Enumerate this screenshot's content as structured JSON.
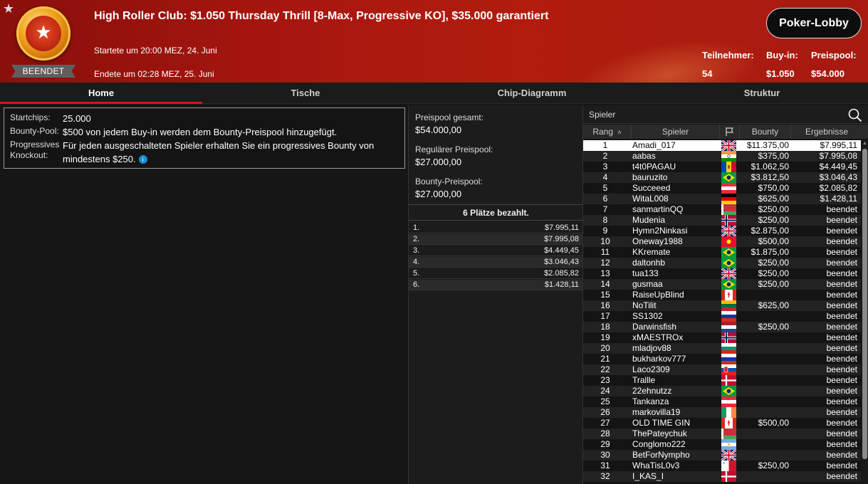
{
  "header": {
    "status": "BEENDET",
    "title": "High Roller Club: $1.050 Thursday Thrill [8-Max, Progressive KO], $35.000 garantiert",
    "started": "Startete um 20:00 MEZ, 24. Juni",
    "ended": "Endete um 02:28 MEZ, 25. Juni",
    "lobby_button": "Poker-Lobby",
    "stats": [
      {
        "label": "Teilnehmer:",
        "value": "54"
      },
      {
        "label": "Buy-in:",
        "value": "$1.050"
      },
      {
        "label": "Preispool:",
        "value": "$54.000"
      }
    ]
  },
  "tabs": [
    "Home",
    "Tische",
    "Chip-Diagramm",
    "Struktur"
  ],
  "info": {
    "startchips_label": "Startchips:",
    "startchips_value": "25.000",
    "bounty_label": "Bounty-Pool:",
    "bounty_value": "$500 von jedem Buy-in werden dem Bounty-Preispool hinzugefügt.",
    "pko_label": "Progressives Knockout:",
    "pko_value": "Für jeden ausgeschalteten Spieler erhalten Sie ein progressives Bounty von mindestens $250.",
    "info_icon": "i"
  },
  "pools": {
    "total_label": "Preispool gesamt:",
    "total_value": "$54.000,00",
    "regular_label": "Regulärer Preispool:",
    "regular_value": "$27.000,00",
    "bounty_label": "Bounty-Preispool:",
    "bounty_value": "$27.000,00"
  },
  "paid_heading": "6 Plätze bezahlt.",
  "payouts": [
    {
      "place": "1.",
      "amount": "$7.995,11"
    },
    {
      "place": "2.",
      "amount": "$7.995,08"
    },
    {
      "place": "3.",
      "amount": "$4.449,45"
    },
    {
      "place": "4.",
      "amount": "$3.046,43"
    },
    {
      "place": "5.",
      "amount": "$2.085,82"
    },
    {
      "place": "6.",
      "amount": "$1.428,11"
    }
  ],
  "players_panel": {
    "search_label": "Spieler",
    "columns": {
      "rank": "Rang",
      "player": "Spieler",
      "bounty": "Bounty",
      "results": "Ergebnisse"
    }
  },
  "players": [
    {
      "rank": "1",
      "name": "Amadi_017",
      "flag": "uk",
      "bounty": "$11.375,00",
      "result": "$7.995,11"
    },
    {
      "rank": "2",
      "name": "aabas",
      "flag": "india",
      "bounty": "$375,00",
      "result": "$7.995,08"
    },
    {
      "rank": "3",
      "name": "t4t0PAGAU",
      "flag": "moldova",
      "bounty": "$1.062,50",
      "result": "$4.449,45"
    },
    {
      "rank": "4",
      "name": "bauruzito",
      "flag": "brazil",
      "bounty": "$3.812,50",
      "result": "$3.046,43"
    },
    {
      "rank": "5",
      "name": "Succeeed",
      "flag": "austria",
      "bounty": "$750,00",
      "result": "$2.085,82"
    },
    {
      "rank": "6",
      "name": "WitaL008",
      "flag": "germany",
      "bounty": "$625,00",
      "result": "$1.428,11"
    },
    {
      "rank": "7",
      "name": "sanmartinQQ",
      "flag": "belarus",
      "bounty": "$250,00",
      "result": "beendet"
    },
    {
      "rank": "8",
      "name": "Mudenia",
      "flag": "norway",
      "bounty": "$250,00",
      "result": "beendet"
    },
    {
      "rank": "9",
      "name": "Hymn2Ninkasi",
      "flag": "uk",
      "bounty": "$2.875,00",
      "result": "beendet"
    },
    {
      "rank": "10",
      "name": "Oneway1988",
      "flag": "kyrgyzstan",
      "bounty": "$500,00",
      "result": "beendet"
    },
    {
      "rank": "11",
      "name": "KKremate",
      "flag": "brazil",
      "bounty": "$1.875,00",
      "result": "beendet"
    },
    {
      "rank": "12",
      "name": "daltonhb",
      "flag": "brazil",
      "bounty": "$250,00",
      "result": "beendet"
    },
    {
      "rank": "13",
      "name": "tua133",
      "flag": "uk",
      "bounty": "$250,00",
      "result": "beendet"
    },
    {
      "rank": "14",
      "name": "gusmaa",
      "flag": "brazil",
      "bounty": "$250,00",
      "result": "beendet"
    },
    {
      "rank": "15",
      "name": "RaiseUpBlind",
      "flag": "canada",
      "bounty": "",
      "result": "beendet"
    },
    {
      "rank": "16",
      "name": "NoTilit",
      "flag": "lithuania",
      "bounty": "$625,00",
      "result": "beendet"
    },
    {
      "rank": "17",
      "name": "SS1302",
      "flag": "russia",
      "bounty": "",
      "result": "beendet"
    },
    {
      "rank": "18",
      "name": "Darwinsfish",
      "flag": "netherlands",
      "bounty": "$250,00",
      "result": "beendet"
    },
    {
      "rank": "19",
      "name": "xMAESTROx",
      "flag": "norway",
      "bounty": "",
      "result": "beendet"
    },
    {
      "rank": "20",
      "name": "mladjov88",
      "flag": "bulgaria",
      "bounty": "",
      "result": "beendet"
    },
    {
      "rank": "21",
      "name": "bukharkov777",
      "flag": "russia",
      "bounty": "",
      "result": "beendet"
    },
    {
      "rank": "22",
      "name": "Laco2309",
      "flag": "slovakia",
      "bounty": "",
      "result": "beendet"
    },
    {
      "rank": "23",
      "name": "Trallle",
      "flag": "denmark",
      "bounty": "",
      "result": "beendet"
    },
    {
      "rank": "24",
      "name": "22ehnutzz",
      "flag": "brazil",
      "bounty": "",
      "result": "beendet"
    },
    {
      "rank": "25",
      "name": "Tankanza",
      "flag": "austria",
      "bounty": "",
      "result": "beendet"
    },
    {
      "rank": "26",
      "name": "markovilla19",
      "flag": "ireland",
      "bounty": "",
      "result": "beendet"
    },
    {
      "rank": "27",
      "name": "OLD TIME GIN",
      "flag": "canada",
      "bounty": "$500,00",
      "result": "beendet"
    },
    {
      "rank": "28",
      "name": "ThePateychuk",
      "flag": "belarus",
      "bounty": "",
      "result": "beendet"
    },
    {
      "rank": "29",
      "name": "Conglomo222",
      "flag": "argentina",
      "bounty": "",
      "result": "beendet"
    },
    {
      "rank": "30",
      "name": "BetForNympho",
      "flag": "uk",
      "bounty": "",
      "result": "beendet"
    },
    {
      "rank": "31",
      "name": "WhaTisL0v3",
      "flag": "malta",
      "bounty": "$250,00",
      "result": "beendet"
    },
    {
      "rank": "32",
      "name": "I_KAS_I",
      "flag": "denmark",
      "bounty": "",
      "result": "beendet"
    }
  ],
  "colors": {
    "accent": "#d7141a",
    "header_red": "#a8170f"
  }
}
